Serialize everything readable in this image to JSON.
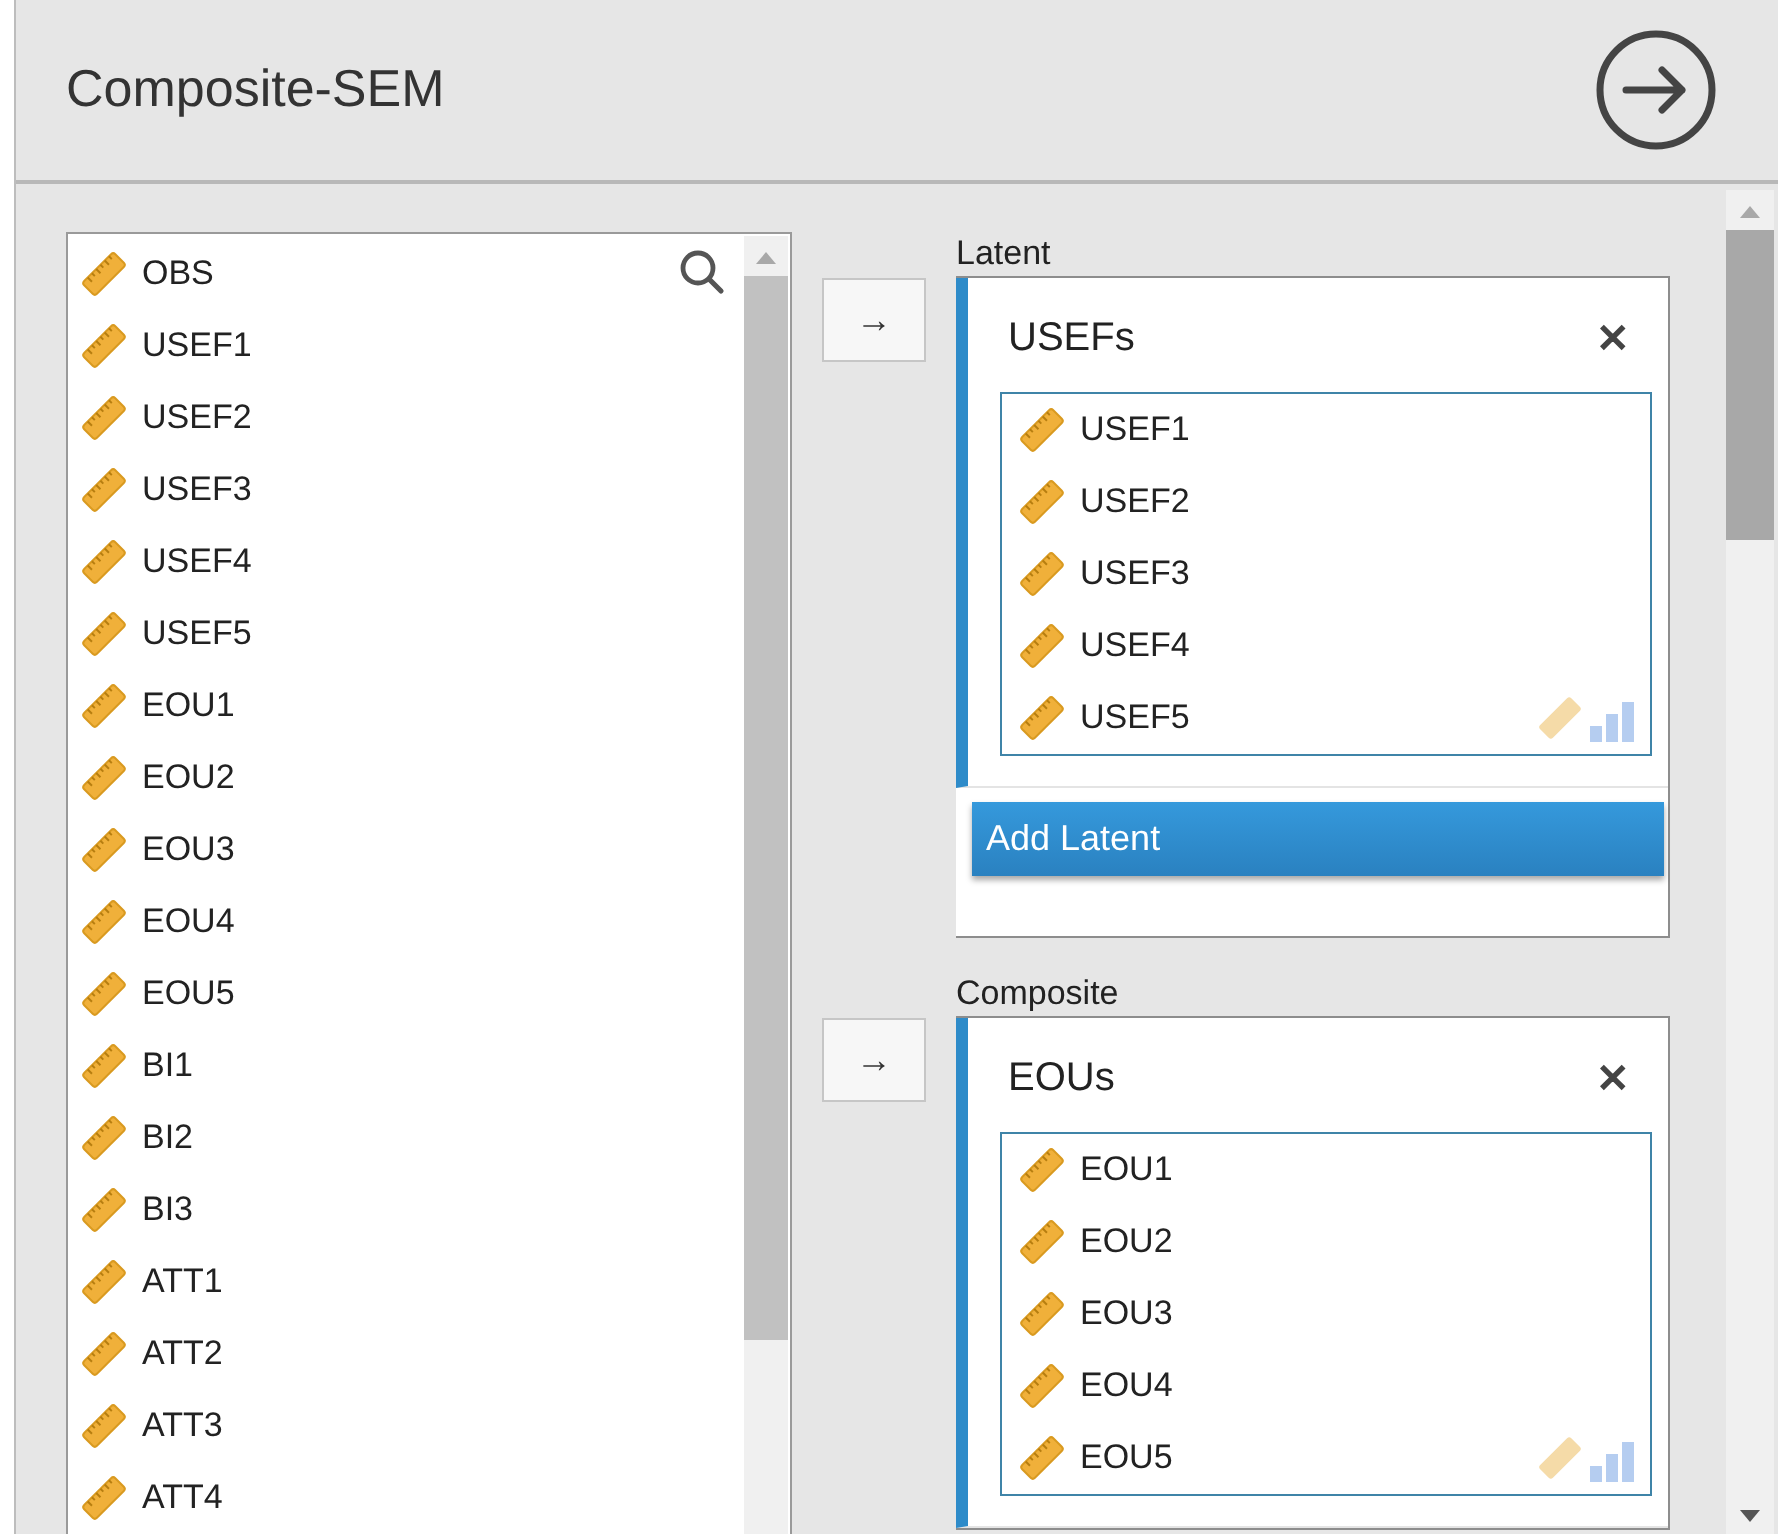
{
  "title": "Composite-SEM",
  "variables": [
    "OBS",
    "USEF1",
    "USEF2",
    "USEF3",
    "USEF4",
    "USEF5",
    "EOU1",
    "EOU2",
    "EOU3",
    "EOU4",
    "EOU5",
    "BI1",
    "BI2",
    "BI3",
    "ATT1",
    "ATT2",
    "ATT3",
    "ATT4"
  ],
  "sections": [
    {
      "label": "Latent",
      "arrow": "→",
      "blocks": [
        {
          "name": "USEFs",
          "close": "✕",
          "items": [
            "USEF1",
            "USEF2",
            "USEF3",
            "USEF4",
            "USEF5"
          ]
        }
      ],
      "add_button": "Add Latent"
    },
    {
      "label": "Composite",
      "arrow": "→",
      "blocks": [
        {
          "name": "EOUs",
          "close": "✕",
          "items": [
            "EOU1",
            "EOU2",
            "EOU3",
            "EOU4",
            "EOU5"
          ]
        }
      ]
    }
  ]
}
